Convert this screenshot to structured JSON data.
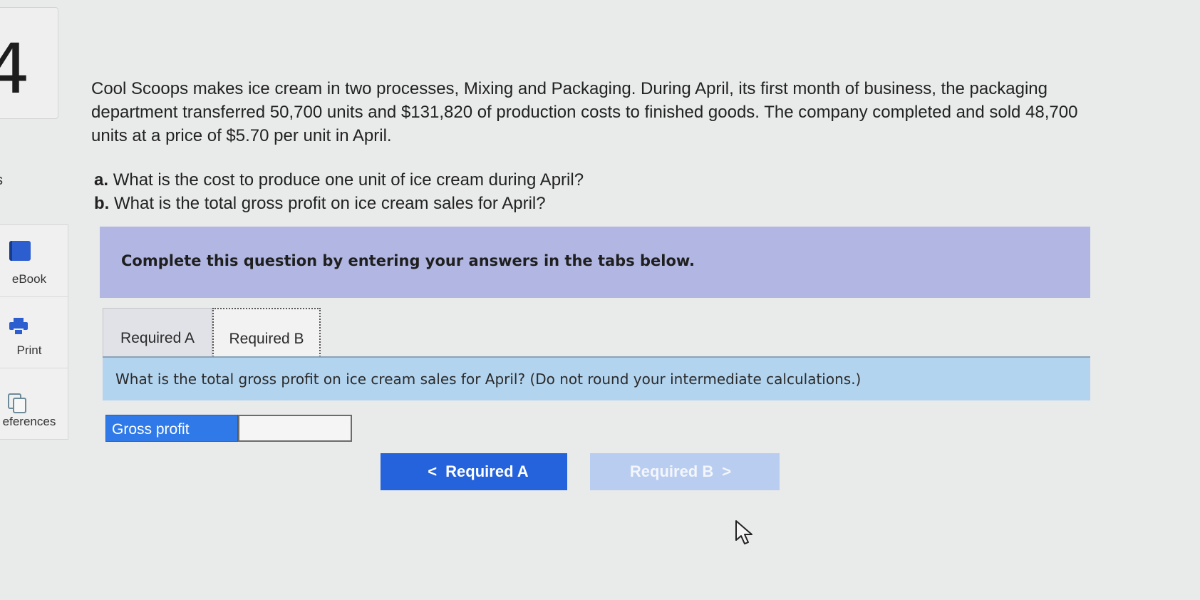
{
  "question_number": "4",
  "side_stub": "s",
  "sidebar": {
    "items": [
      {
        "label": "eBook",
        "icon": "book-icon"
      },
      {
        "label": "Print",
        "icon": "printer-icon"
      },
      {
        "label": "eferences",
        "icon": "references-icon"
      }
    ]
  },
  "problem": {
    "line1": "Cool Scoops makes ice cream in two processes, Mixing and Packaging. During April, its first month of business, the packaging",
    "line2": "department transferred 50,700 units and $131,820 of production costs to finished goods. The company completed and sold 48,700",
    "line3": "units at a price of $5.70 per unit in April.",
    "question_a_prefix": "a.",
    "question_a": "What is the cost to produce one unit of ice cream during April?",
    "question_b_prefix": "b.",
    "question_b": "What is the total gross profit on ice cream sales for April?"
  },
  "instruction": "Complete this question by entering your answers in the tabs below.",
  "tabs": [
    {
      "label": "Required A"
    },
    {
      "label": "Required B"
    }
  ],
  "active_question": "What is the total gross profit on ice cream sales for April? (Do not round your intermediate calculations.)",
  "answer": {
    "label": "Gross profit",
    "value": ""
  },
  "navigation": {
    "prev_label": "Required A",
    "prev_chevron": "<",
    "next_label": "Required B",
    "next_chevron": ">"
  },
  "colors": {
    "banner": "#b1b7e2",
    "question_bar": "#b3d4ef",
    "answer_label": "#2f7ae8",
    "primary_button": "#2463dc",
    "disabled_button": "#b9cdf1"
  }
}
